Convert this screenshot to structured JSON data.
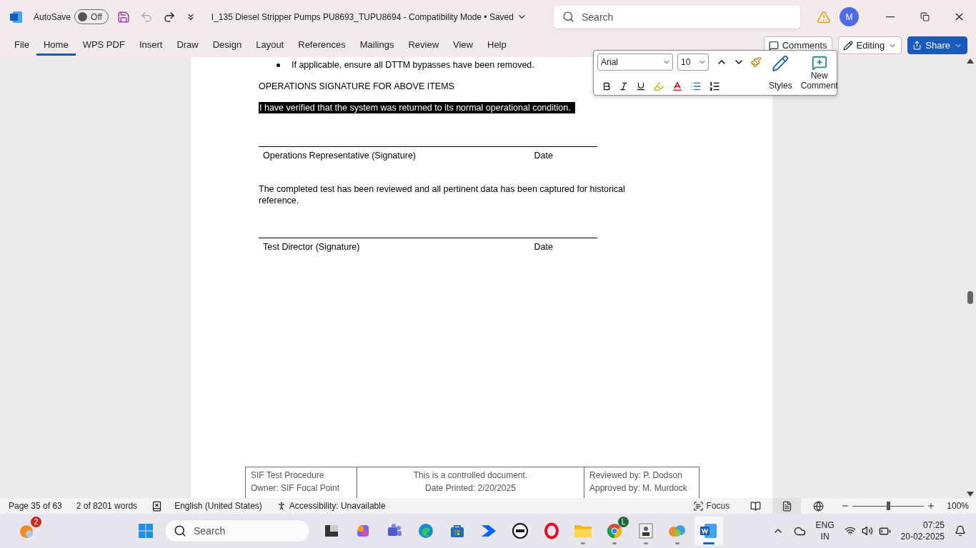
{
  "title_bar": {
    "autosave_label": "AutoSave",
    "autosave": {
      "on": false,
      "label": "Off"
    },
    "doc_title": "I_135 Diesel Stripper Pumps PU8693_TUPU8694  -  Compatibility Mode • Saved",
    "search_placeholder": "Search",
    "avatar": "M"
  },
  "ribbon": {
    "tabs": [
      {
        "label": "File",
        "selected": false
      },
      {
        "label": "Home",
        "selected": true
      },
      {
        "label": "WPS PDF",
        "selected": false
      },
      {
        "label": "Insert",
        "selected": false
      },
      {
        "label": "Draw",
        "selected": false
      },
      {
        "label": "Design",
        "selected": false
      },
      {
        "label": "Layout",
        "selected": false
      },
      {
        "label": "References",
        "selected": false
      },
      {
        "label": "Mailings",
        "selected": false
      },
      {
        "label": "Review",
        "selected": false
      },
      {
        "label": "View",
        "selected": false
      },
      {
        "label": "Help",
        "selected": false
      }
    ],
    "comments": "Comments",
    "editing": "Editing",
    "share": "Share"
  },
  "mini_toolbar": {
    "font": "Arial",
    "size": "10",
    "styles": "Styles",
    "new_comment": "New Comment"
  },
  "document": {
    "bullet": "If applicable, ensure all DTTM bypasses have been removed.",
    "heading": "OPERATIONS SIGNATURE FOR ABOVE ITEMS",
    "selected_sentence": {
      "text": "I have verified that the system was returned to its normal operational condition.",
      "selected": true
    },
    "signature_1": {
      "label": "Operations Representative (Signature)",
      "date": "Date"
    },
    "paragraph": "The completed test has been reviewed and all pertinent data has been captured for historical reference.",
    "signature_2": {
      "label": "Test Director (Signature)",
      "date": "Date"
    },
    "footer": [
      [
        "SIF Test Procedure",
        "Owner: SIF Focal Point"
      ],
      [
        "This is a controlled document.",
        "Date Printed: 2/20/2025"
      ],
      [
        "Reviewed by: P. Dodson",
        "Approved by: M. Murdock"
      ]
    ]
  },
  "status_bar": {
    "page": "Page 35 of 63",
    "words": "2 of 8201 words",
    "language": "English (United States)",
    "accessibility": "Accessibility: Unavailable",
    "focus": "Focus",
    "views": [
      {
        "kind": "read",
        "selected": false
      },
      {
        "kind": "print",
        "selected": true
      },
      {
        "kind": "web",
        "selected": false
      }
    ],
    "zoom": {
      "level": 0.5
    },
    "zoom_label": "100%"
  },
  "taskbar": {
    "widgets_badge": "2",
    "search_placeholder": "Search",
    "apps": [
      {
        "kind": "terminal",
        "running": false,
        "active": false
      },
      {
        "kind": "swirl",
        "running": false,
        "active": false
      },
      {
        "kind": "people",
        "running": false,
        "active": false
      },
      {
        "kind": "edge",
        "running": false,
        "active": false
      },
      {
        "kind": "store",
        "running": false,
        "active": false
      },
      {
        "kind": "arrow",
        "running": false,
        "active": false
      },
      {
        "kind": "dell",
        "running": false,
        "active": false
      },
      {
        "kind": "ring",
        "running": false,
        "active": false
      },
      {
        "kind": "folder",
        "running": true,
        "active": false
      },
      {
        "kind": "chrome",
        "badge": "L",
        "running": true,
        "active": false
      },
      {
        "kind": "portrait",
        "running": true,
        "active": false
      },
      {
        "kind": "cloud",
        "running": true,
        "active": false
      },
      {
        "kind": "word",
        "running": true,
        "active": true
      }
    ],
    "lang_1": "ENG",
    "lang_2": "IN",
    "time": "07:25",
    "date": "20-02-2025"
  }
}
